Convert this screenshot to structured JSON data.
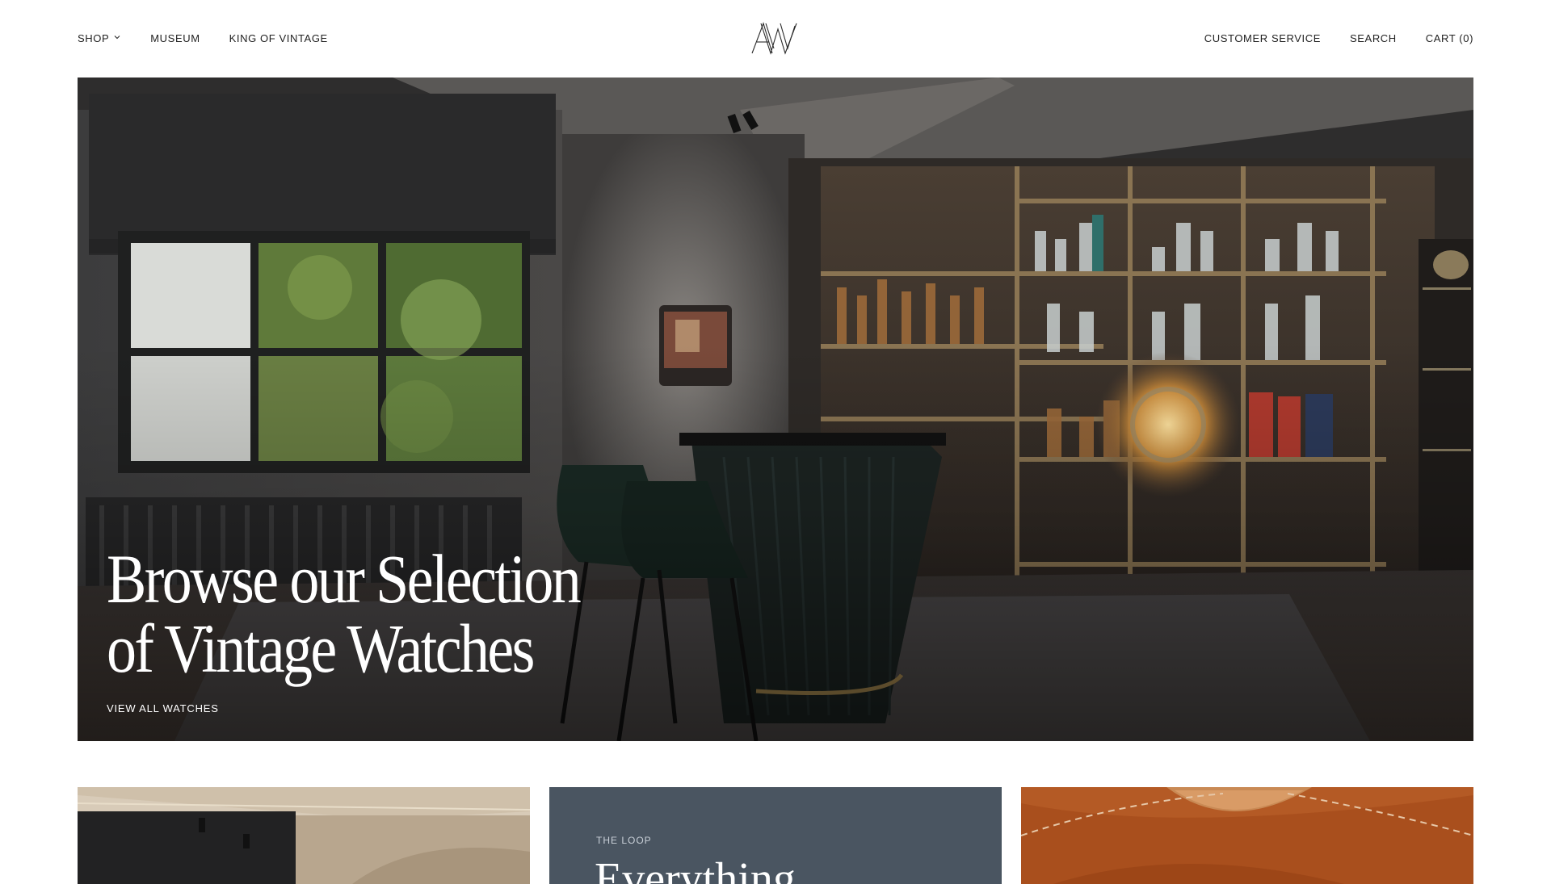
{
  "header": {
    "nav_left": [
      {
        "label": "SHOP",
        "has_dropdown": true
      },
      {
        "label": "MUSEUM"
      },
      {
        "label": "KING OF VINTAGE"
      }
    ],
    "nav_right": [
      {
        "label": "CUSTOMER SERVICE"
      },
      {
        "label": "SEARCH"
      },
      {
        "label": "CART (0)"
      }
    ],
    "logo_text": "AW"
  },
  "hero": {
    "title_line1": "Browse our Selection",
    "title_line2": "of Vintage Watches",
    "cta_label": "VIEW ALL WATCHES"
  },
  "cards": [
    {
      "type": "image",
      "icon": "interior-image"
    },
    {
      "type": "text",
      "eyebrow": "THE LOOP",
      "heading": "Everything"
    },
    {
      "type": "image",
      "icon": "leather-image"
    }
  ],
  "colors": {
    "text": "#222222",
    "hero_text": "#ffffff",
    "card_slate": "#4a5561",
    "card_leather": "#b8602c"
  }
}
